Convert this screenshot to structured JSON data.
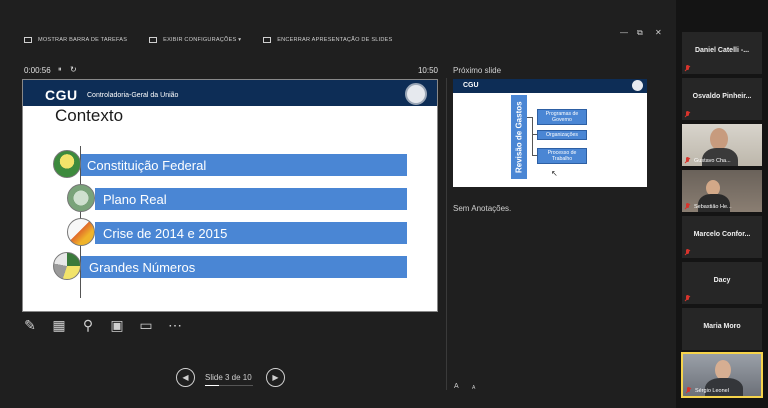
{
  "window": {
    "minimize": "—",
    "restore": "⧉",
    "close": "✕"
  },
  "toolbar": {
    "show_taskbar": "MOSTRAR BARRA DE TAREFAS",
    "display_settings": "EXIBIR CONFIGURAÇÕES ▾",
    "end_show": "ENCERRAR APRESENTAÇÃO DE SLIDES"
  },
  "timer": {
    "elapsed": "0:00:56",
    "pause": "⏸",
    "reset": "↻",
    "clock": "10:50"
  },
  "current_slide": {
    "logo": "CGU",
    "org": "Controladoria-Geral da União",
    "title": "Contexto",
    "items": [
      "Constituição Federal",
      "Plano Real",
      "Crise de 2014 e 2015",
      "Grandes Números"
    ]
  },
  "next_slide": {
    "label": "Próximo slide",
    "logo": "CGU",
    "vertical_title": "Revisão de Gastos",
    "boxes": [
      "Programas de Governo",
      "Organizações",
      "Processo de Trabalho"
    ]
  },
  "notes": "Sem Anotações.",
  "text_size": {
    "increase": "A",
    "decrease": "A"
  },
  "navigation": {
    "prev": "◀",
    "next": "▶",
    "slide_counter": "Slide 3 de 10",
    "progress": 0.3
  },
  "tools": {
    "pen": "pen-icon",
    "slides": "grid-icon",
    "zoom": "magnifier-icon",
    "pointer": "laser-pointer-icon",
    "subtitles": "subtitles-icon",
    "more": "more-icon"
  },
  "participants": [
    {
      "name": "Daniel Catelli -...",
      "video": false
    },
    {
      "name": "Osvaldo Pinheir...",
      "video": false
    },
    {
      "name": "Gustavo Cha...",
      "video": true
    },
    {
      "name": "Sebastião He...",
      "video": true
    },
    {
      "name": "Marcelo Confor...",
      "video": false
    },
    {
      "name": "Dacy",
      "video": false
    },
    {
      "name": "Maria Moro",
      "video": false
    },
    {
      "name": "Sérgio Leonel",
      "video": true
    }
  ],
  "colors": {
    "slide_accent": "#4a86d4",
    "slide_header": "#0d2d56",
    "speaker_border": "#f6d44c",
    "mic_muted": "#d8342c"
  }
}
